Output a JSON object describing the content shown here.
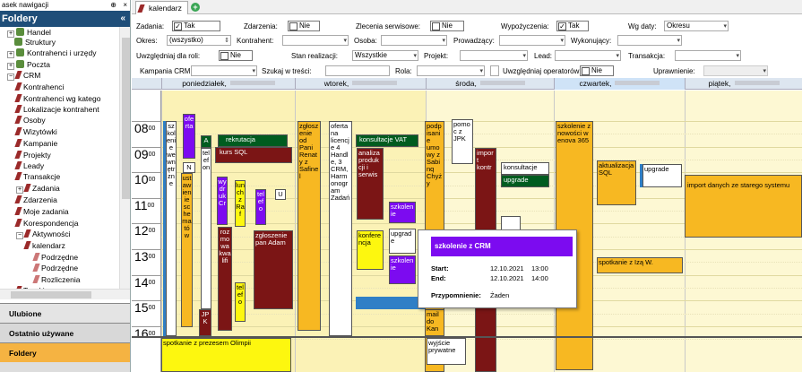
{
  "nav": {
    "title": "asek nawigacji",
    "pin": "⊕",
    "close": "×",
    "folders_title": "Foldery",
    "collapse": "«",
    "items": [
      {
        "label": "Handel",
        "icon": "folder",
        "expand": "+"
      },
      {
        "label": "Struktury",
        "icon": "structure"
      },
      {
        "label": "Kontrahenci i urzędy",
        "icon": "folder",
        "expand": "+"
      },
      {
        "label": "Poczta",
        "icon": "folder",
        "expand": "+"
      },
      {
        "label": "CRM",
        "icon": "pen",
        "expand": "−"
      },
      {
        "label": "Kontrahenci",
        "icon": "pen"
      },
      {
        "label": "Kontrahenci wg katego",
        "icon": "pen"
      },
      {
        "label": "Lokalizacje kontrahent",
        "icon": "pen"
      },
      {
        "label": "Osoby",
        "icon": "pen"
      },
      {
        "label": "Wizytówki",
        "icon": "pen"
      },
      {
        "label": "Kampanie",
        "icon": "pen"
      },
      {
        "label": "Projekty",
        "icon": "pen"
      },
      {
        "label": "Leady",
        "icon": "pen"
      },
      {
        "label": "Transakcje",
        "icon": "pen"
      },
      {
        "label": "Zadania",
        "icon": "pen",
        "expand": "+"
      },
      {
        "label": "Zdarzenia",
        "icon": "pen"
      },
      {
        "label": "Moje zadania",
        "icon": "pen"
      },
      {
        "label": "Korespondencja",
        "icon": "pen"
      },
      {
        "label": "Aktywności",
        "icon": "pen",
        "expand": "−"
      },
      {
        "label": "kalendarz",
        "icon": "pen"
      },
      {
        "label": "Podrzędne",
        "icon": "pen-light"
      },
      {
        "label": "Podrzędne",
        "icon": "pen-light"
      },
      {
        "label": "Rozliczenia",
        "icon": "pen-light"
      },
      {
        "label": "Teczki",
        "icon": "pen"
      }
    ],
    "buttons": [
      "Ulubione",
      "Ostatnio używane",
      "Foldery"
    ]
  },
  "tab": {
    "label": "kalendarz",
    "add": "+"
  },
  "filters": {
    "zadania_label": "Zadania:",
    "zadania_value": "Tak",
    "zadania_checked": "✓",
    "zdarzenia_label": "Zdarzenia:",
    "zdarzenia_value": "Nie",
    "zlecenia_label": "Zlecenia serwisowe:",
    "zlecenia_value": "Nie",
    "wypozyczenia_label": "Wypożyczenia:",
    "wypozyczenia_value": "Tak",
    "wypozyczenia_checked": "✓",
    "wgdaty_label": "Wg daty:",
    "wgdaty_value": "Okresu",
    "okres_label": "Okres:",
    "okres_value": "(wszystko)",
    "kontrahent_label": "Kontrahent:",
    "osoba_label": "Osoba:",
    "prowadzacy_label": "Prowadzący:",
    "wykonujacy_label": "Wykonujący:",
    "uwzgl_label": "Uwzględniaj dla roli:",
    "uwzgl_value": "Nie",
    "stan_label": "Stan realizacji:",
    "stan_value": "Wszystkie",
    "projekt_label": "Projekt:",
    "lead_label": "Lead:",
    "transakcja_label": "Transakcja:",
    "kampania_label": "Kampania CRM:",
    "szukaj_label": "Szukaj w treści:",
    "rola_label": "Rola:",
    "operatorow_label": "Uwzględniaj operatorów:",
    "operatorow_value": "Nie",
    "uprawnienie_label": "Uprawnienie:",
    "dropdown": "▾",
    "spinner": "⇕"
  },
  "days": [
    "poniedziałek,",
    "wtorek,",
    "środa,",
    "czwartek,",
    "piątek,"
  ],
  "hours": [
    {
      "h": "08",
      "m": "00"
    },
    {
      "h": "09",
      "m": "00"
    },
    {
      "h": "10",
      "m": "00"
    },
    {
      "h": "11",
      "m": "00"
    },
    {
      "h": "12",
      "m": "00"
    },
    {
      "h": "13",
      "m": "00"
    },
    {
      "h": "14",
      "m": "00"
    },
    {
      "h": "15",
      "m": "00"
    },
    {
      "h": "16",
      "m": "00"
    }
  ],
  "events": {
    "e1": "szkolenie wewnętrzne",
    "e2": "oferta",
    "e3": "N",
    "e4": "ustawienie schematów",
    "e5": "A",
    "e6": "telefon",
    "e7": "JPK",
    "e8": "rekrutacja",
    "e9": "kurs SQL",
    "e10": "wydruk Cr",
    "e11": "lunch z Raf",
    "e12": "rozmowa kwalifi",
    "e13": "telefo",
    "e14": "telefo",
    "e15": "U",
    "e16": "zgłoszenie pan Adam",
    "e17": "spotkanie z prezesem Olimpii",
    "e18": "zgłoszenie od Pani Renaty z Safinel",
    "e19": "oferta na licencje 4 Handle, 3 CRM, Harmonogram Zadań",
    "e20": "konsultacje VAT",
    "e21": "analiza produkcji i serwis",
    "e22": "szkolenie",
    "e23": "konferencja",
    "e24": "upgrade",
    "e25": "szkolenie",
    "e26": "podpisanie umowy z Sabinq Chyży",
    "e27": "pomoc z JPK",
    "e28": "import kontr",
    "e29": "konsultacje",
    "e30": "upgrade",
    "e31": "mail do Kan",
    "e32": "wyjście prywatne",
    "e33": "szkolenie z nowości w enova 365",
    "e34": "aktualizacja SQL",
    "e35": "upgrade",
    "e36": "spotkanie z Izą W.",
    "e37": "import danych ze starego systemu"
  },
  "popup": {
    "title": "szkolenie z CRM",
    "start_label": "Start:",
    "start_date": "12.10.2021",
    "start_time": "13:00",
    "end_label": "End:",
    "end_date": "12.10.2021",
    "end_time": "14:00",
    "reminder_label": "Przypomnienie:",
    "reminder_value": "Żaden"
  }
}
